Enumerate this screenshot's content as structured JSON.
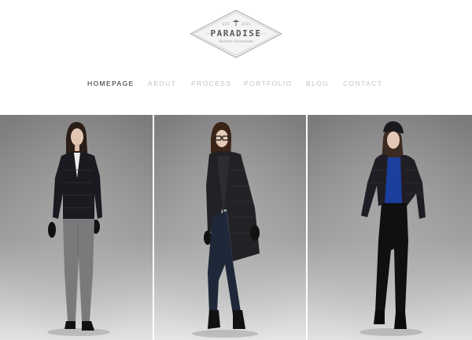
{
  "logo": {
    "name": "PARADISE",
    "small_left": "EST",
    "small_right": "2015",
    "tagline": "Fashion Showroom",
    "icon": "umbrella-icon"
  },
  "nav": {
    "items": [
      {
        "label": "HOMEPAGE",
        "active": true
      },
      {
        "label": "ABOUT",
        "active": false
      },
      {
        "label": "PROCESS",
        "active": false
      },
      {
        "label": "PORTFOLIO",
        "active": false
      },
      {
        "label": "BLOG",
        "active": false
      },
      {
        "label": "CONTACT",
        "active": false
      }
    ]
  },
  "gallery": {
    "images": [
      {
        "subject": "model-quilted-jacket-grey-trousers"
      },
      {
        "subject": "model-quilted-long-coat-glasses"
      },
      {
        "subject": "model-quilted-jacket-beanie-blue-top"
      }
    ]
  },
  "colors": {
    "active_nav": "#222222",
    "inactive_nav": "#c4c4c4",
    "logo_gray": "#5a5a5a"
  }
}
